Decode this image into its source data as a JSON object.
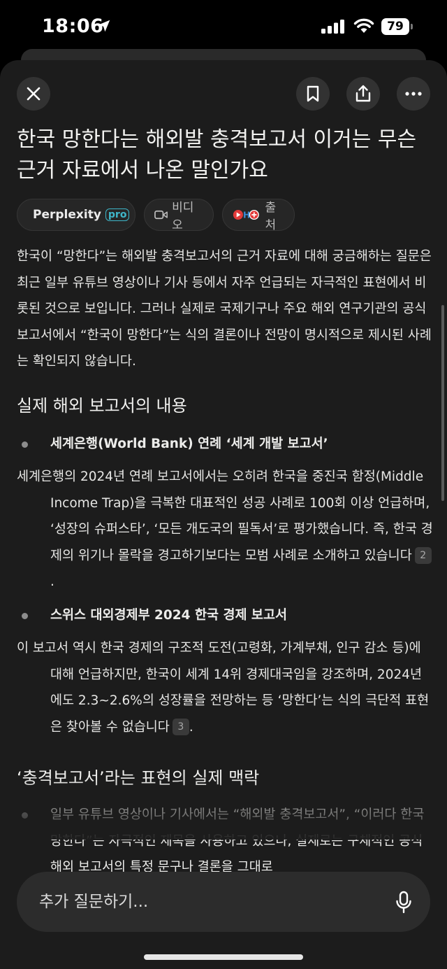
{
  "status_bar": {
    "time": "18:06",
    "battery": "79"
  },
  "toolbar": {
    "close_icon": "close-icon",
    "bookmark_icon": "bookmark-icon",
    "share_icon": "share-icon",
    "more_icon": "more-icon"
  },
  "title": "한국 망한다는 해외발 충격보고서 이거는 무슨 근거 자료에서 나온 말인가요",
  "chips": {
    "perplexity": {
      "label": "Perplexity",
      "badge": "pro"
    },
    "video": {
      "label": "비디오"
    },
    "source": {
      "label": "출처"
    }
  },
  "answer": {
    "intro": "한국이 “망한다”는 해외발 충격보고서의 근거 자료에 대해 궁금해하는 질문은 최근 일부 유튜브 영상이나 기사 등에서 자주 언급되는 자극적인 표현에서 비롯된 것으로 보입니다. 그러나 실제로 국제기구나 주요 해외 연구기관의 공식 보고서에서 “한국이 망한다”는 식의 결론이나 전망이 명시적으로 제시된 사례는 확인되지 않습니다.",
    "section1": {
      "heading": "실제 해외 보고서의 내용",
      "item1": {
        "title": "세계은행(World Bank) 연례 ‘세계 개발 보고서’",
        "body": "세계은행의 2024년 연례 보고서에서는 오히려 한국을 중진국 함정(Middle Income Trap)을 극복한 대표적인 성공 사례로 100회 이상 언급하며, ‘성장의 슈퍼스타’, ‘모든 개도국의 필독서’로 평가했습니다. 즉, 한국 경제의 위기나 몰락을 경고하기보다는 모범 사례로 소개하고 있습니다",
        "cite": "2"
      },
      "item2": {
        "title": "스위스 대외경제부 2024 한국 경제 보고서",
        "body": "이 보고서 역시 한국 경제의 구조적 도전(고령화, 가계부채, 인구 감소 등)에 대해 언급하지만, 한국이 세계 14위 경제대국임을 강조하며, 2024년에도 2.3~2.6%의 성장률을 전망하는 등 ‘망한다’는 식의 극단적 표현은 찾아볼 수 없습니다",
        "cite": "3"
      }
    },
    "section2": {
      "heading": "‘충격보고서’라는 표현의 실제 맥락",
      "item1": {
        "body": "일부 유튜브 영상이나 기사에서는 “해외발 충격보고서”, “이러다 한국 망한다”는 자극적인 제목을 사용하고 있으나, 실제로는 구체적인 공식 해외 보고서의 특정 문구나 결론을 그대로"
      }
    },
    "period": "."
  },
  "ask": {
    "placeholder": "추가 질문하기..."
  }
}
